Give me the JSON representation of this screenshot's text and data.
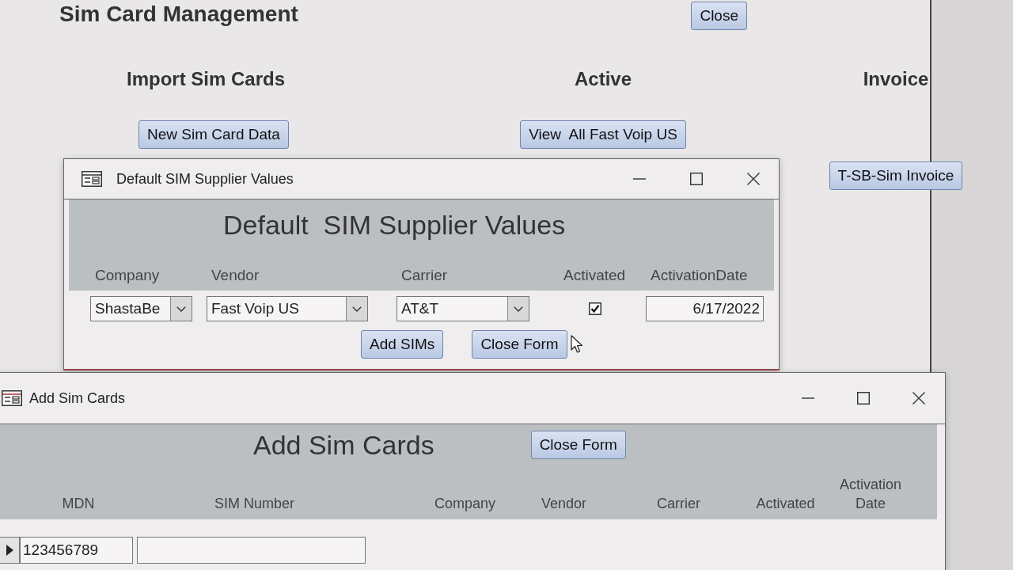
{
  "main_form": {
    "title": "Sim Card Management",
    "close_button": "Close",
    "sections": [
      {
        "heading": "Import Sim Cards",
        "button": "New Sim Card Data"
      },
      {
        "heading": "Active",
        "button": "View  All Fast Voip US"
      },
      {
        "heading": "Invoice",
        "button": "T-SB-Sim Invoice"
      }
    ]
  },
  "supplier_window": {
    "title": "Default SIM Supplier Values",
    "heading": "Default  SIM Supplier Values",
    "fields": [
      {
        "label": "Company",
        "kind": "combo",
        "value": "ShastaBe"
      },
      {
        "label": "Vendor",
        "kind": "combo",
        "value": "Fast Voip US"
      },
      {
        "label": "Carrier",
        "kind": "combo",
        "value": "AT&T"
      },
      {
        "label": "Activated",
        "kind": "checkbox",
        "checked": true
      },
      {
        "label": "ActivationDate",
        "kind": "date",
        "value": "6/17/2022"
      }
    ],
    "buttons": [
      "Add SIMs",
      "Close Form"
    ]
  },
  "add_window": {
    "title": "Add Sim Cards",
    "heading": "Add Sim Cards",
    "close_button": "Close Form",
    "columns": [
      "MDN",
      "SIM Number",
      "Company",
      "Vendor",
      "Carrier",
      "Activated",
      "Activation Date"
    ],
    "rows": [
      {
        "selected": true,
        "mdn": "123456789"
      }
    ]
  }
}
